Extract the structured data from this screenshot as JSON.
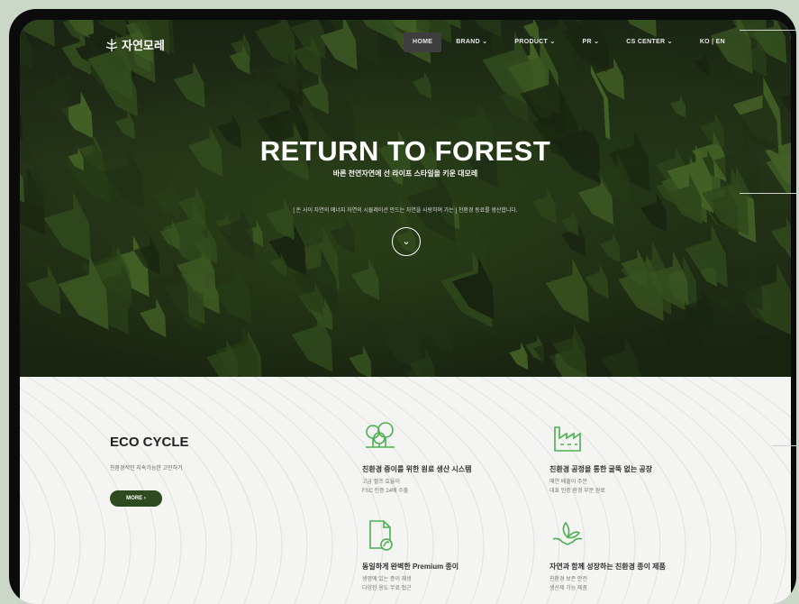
{
  "nav": {
    "logo": "자연모레",
    "items": [
      {
        "label": "HOME",
        "active": true
      },
      {
        "label": "BRAND ⌄",
        "active": false
      },
      {
        "label": "PRODUCT ⌄",
        "active": false
      },
      {
        "label": "PR ⌄",
        "active": false
      },
      {
        "label": "CS CENTER ⌄",
        "active": false
      },
      {
        "label": "KO | EN",
        "active": false
      }
    ]
  },
  "hero": {
    "title": "RETURN TO FOREST",
    "subtitle": "바른 천연자연에 선 라이프 스타일을 키운 대모레",
    "description": "[ 돈 사이 자연의 에너지 자연의 시뮬레이션 만드는 자연을 사랑하며 가는 ] 천환경 동료를 생산합니다.",
    "scroll_icon": "chevron-down-icon"
  },
  "eco": {
    "title": "ECO CYCLE",
    "description": "친환경적인 지속가능한 고민하기",
    "more_label": "MORE  ›",
    "features": [
      {
        "icon": "trees-icon",
        "title": "친환경 증이를 위한 원료 생산 시스템",
        "lines": [
          "고급 펄프 효율이",
          "FSC 인증 24배 수출"
        ]
      },
      {
        "icon": "factory-icon",
        "title": "친환경 공정을 통한 굴뚝 없는 공장",
        "lines": [
          "매연 배출이 주문",
          "대표 인증 환경 부문 완료"
        ]
      },
      {
        "icon": "document-leaf-icon",
        "title": "동일하게 완벽한 Premium 종이",
        "lines": [
          "생명에 있는 종이 재생",
          "다양한 용도 무료 접근"
        ]
      },
      {
        "icon": "hands-leaf-icon",
        "title": "자연과 함께 성장하는 친환경 종이 제품",
        "lines": [
          "친환경 보존 안전",
          "생산제 가능 제품"
        ]
      }
    ]
  },
  "colors": {
    "accent": "#2e4a1e",
    "icon_green": "#4caf50"
  }
}
